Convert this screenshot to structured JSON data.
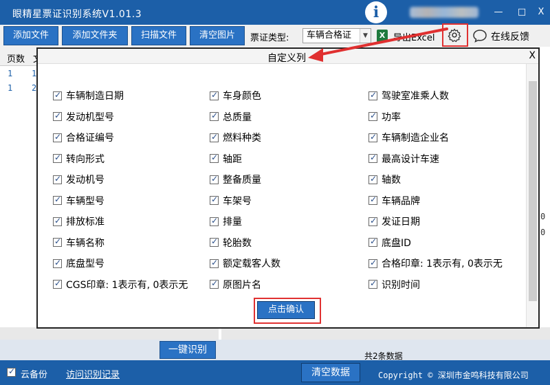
{
  "titlebar": {
    "title": "眼精星票证识别系统V1.01.3",
    "logo_letter": "i",
    "minimize": "—",
    "restore": "□",
    "close": "X"
  },
  "toolbar": {
    "add_file": "添加文件",
    "add_folder": "添加文件夹",
    "scan_file": "扫描文件",
    "clear_images": "清空图片",
    "ticket_type_label": "票证类型:",
    "ticket_type_value": "车辆合格证",
    "excel_icon_letter": "X",
    "export_excel": "导出Excel",
    "feedback": "在线反馈"
  },
  "grid": {
    "header_page": "页数",
    "header_page_2": "文",
    "rows": [
      {
        "page": "1",
        "col2": "1"
      },
      {
        "page": "1",
        "col2": "2"
      }
    ],
    "right_vals": [
      "0",
      "0"
    ]
  },
  "dialog": {
    "title": "自定义列",
    "close": "X",
    "confirm": "点击确认",
    "fields": [
      "车辆制造日期",
      "车身颜色",
      "驾驶室准乘人数",
      "发动机型号",
      "总质量",
      "功率",
      "合格证编号",
      "燃料种类",
      "车辆制造企业名",
      "转向形式",
      "轴距",
      "最高设计车速",
      "发动机号",
      "整备质量",
      "轴数",
      "车辆型号",
      "车架号",
      "车辆品牌",
      "排放标准",
      "排量",
      "发证日期",
      "车辆名称",
      "轮胎数",
      "底盘ID",
      "底盘型号",
      "额定载客人数",
      "合格印章: 1表示有, 0表示无",
      "CGS印章: 1表示有, 0表示无",
      "原图片名",
      "识别时间"
    ]
  },
  "bottom": {
    "recognize": "一键识别",
    "count": "共2条数据"
  },
  "status": {
    "backup": "云备份",
    "visit_records": "访问识别记录",
    "clear_data": "清空数据",
    "copyright": "Copyright © 深圳市金鸣科技有限公司"
  },
  "colors": {
    "primary": "#1c5fa8",
    "button": "#2a72c4",
    "highlight": "#e03030"
  }
}
